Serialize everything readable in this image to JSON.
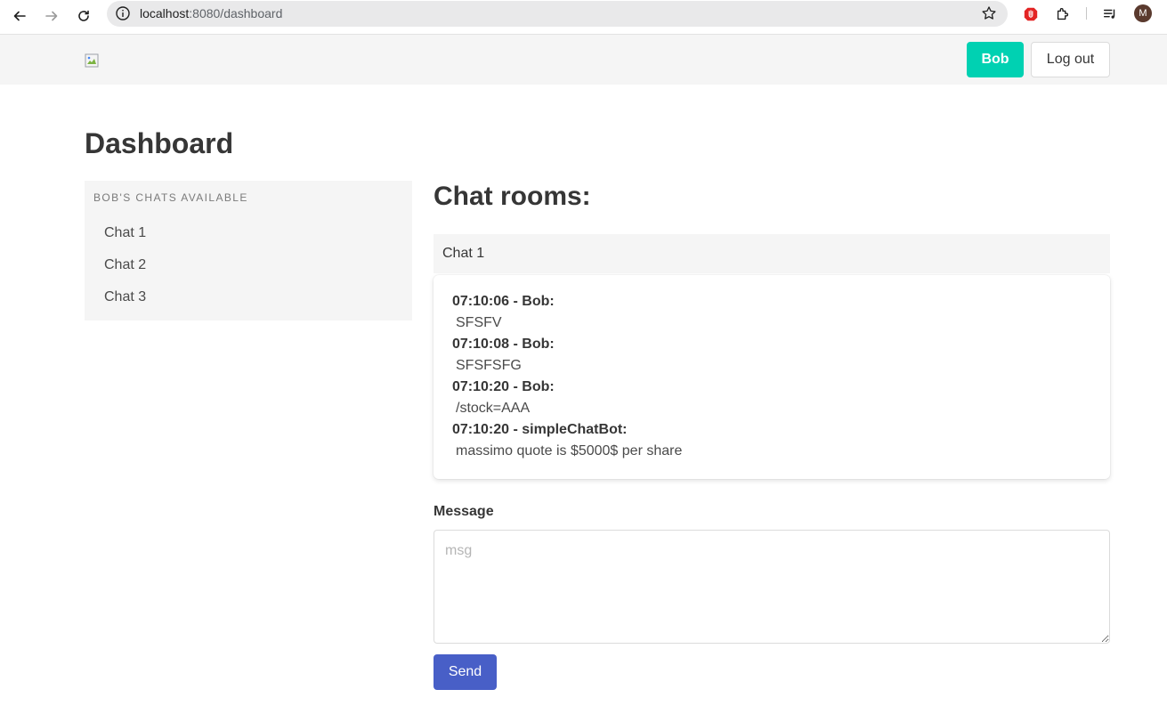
{
  "browser": {
    "url_host": "localhost",
    "url_path": ":8080/dashboard",
    "profile_initial": "M"
  },
  "navbar": {
    "user_button_label": "Bob",
    "logout_button_label": "Log out",
    "accent_color": "#00d1b2"
  },
  "page": {
    "title": "Dashboard"
  },
  "sidebar": {
    "heading": "BOB'S CHATS AVAILABLE",
    "items": [
      {
        "label": "Chat 1"
      },
      {
        "label": "Chat 2"
      },
      {
        "label": "Chat 3"
      }
    ]
  },
  "chat": {
    "section_title": "Chat rooms:",
    "active_room": "Chat 1",
    "messages": [
      {
        "header": "07:10:06 - Bob:",
        "text": "SFSFV"
      },
      {
        "header": "07:10:08 - Bob:",
        "text": "SFSFSFG"
      },
      {
        "header": "07:10:20 - Bob:",
        "text": "/stock=AAA"
      },
      {
        "header": "07:10:20 - simpleChatBot:",
        "text": "massimo quote is $5000$ per share"
      }
    ]
  },
  "form": {
    "message_label": "Message",
    "message_placeholder": "msg",
    "send_button_label": "Send",
    "send_color": "#485fc7"
  }
}
